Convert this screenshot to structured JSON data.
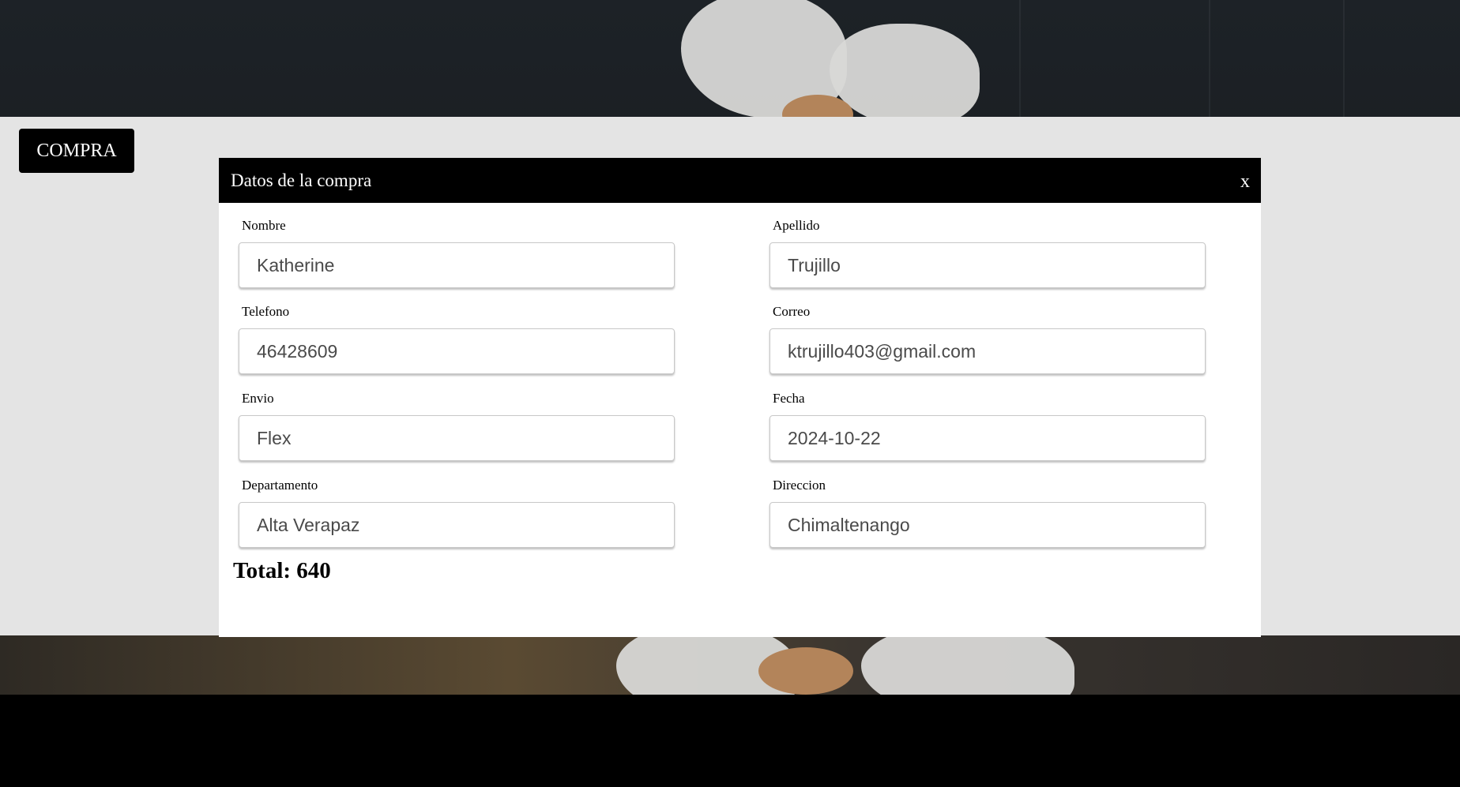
{
  "page": {
    "compra_button_label": "COMPRA"
  },
  "modal": {
    "title": "Datos de la compra",
    "close_label": "x",
    "fields": [
      {
        "label": "Nombre",
        "value": "Katherine"
      },
      {
        "label": "Apellido",
        "value": "Trujillo"
      },
      {
        "label": "Telefono",
        "value": "46428609"
      },
      {
        "label": "Correo",
        "value": "ktrujillo403@gmail.com"
      },
      {
        "label": "Envio",
        "value": "Flex"
      },
      {
        "label": "Fecha",
        "value": "2024-10-22"
      },
      {
        "label": "Departamento",
        "value": "Alta Verapaz"
      },
      {
        "label": "Direccion",
        "value": "Chimaltenango"
      }
    ],
    "total_text": "Total: 640"
  },
  "colors": {
    "header_bg": "#000000",
    "overlay_band": "#e4e4e4",
    "modal_bg": "#ffffff"
  }
}
